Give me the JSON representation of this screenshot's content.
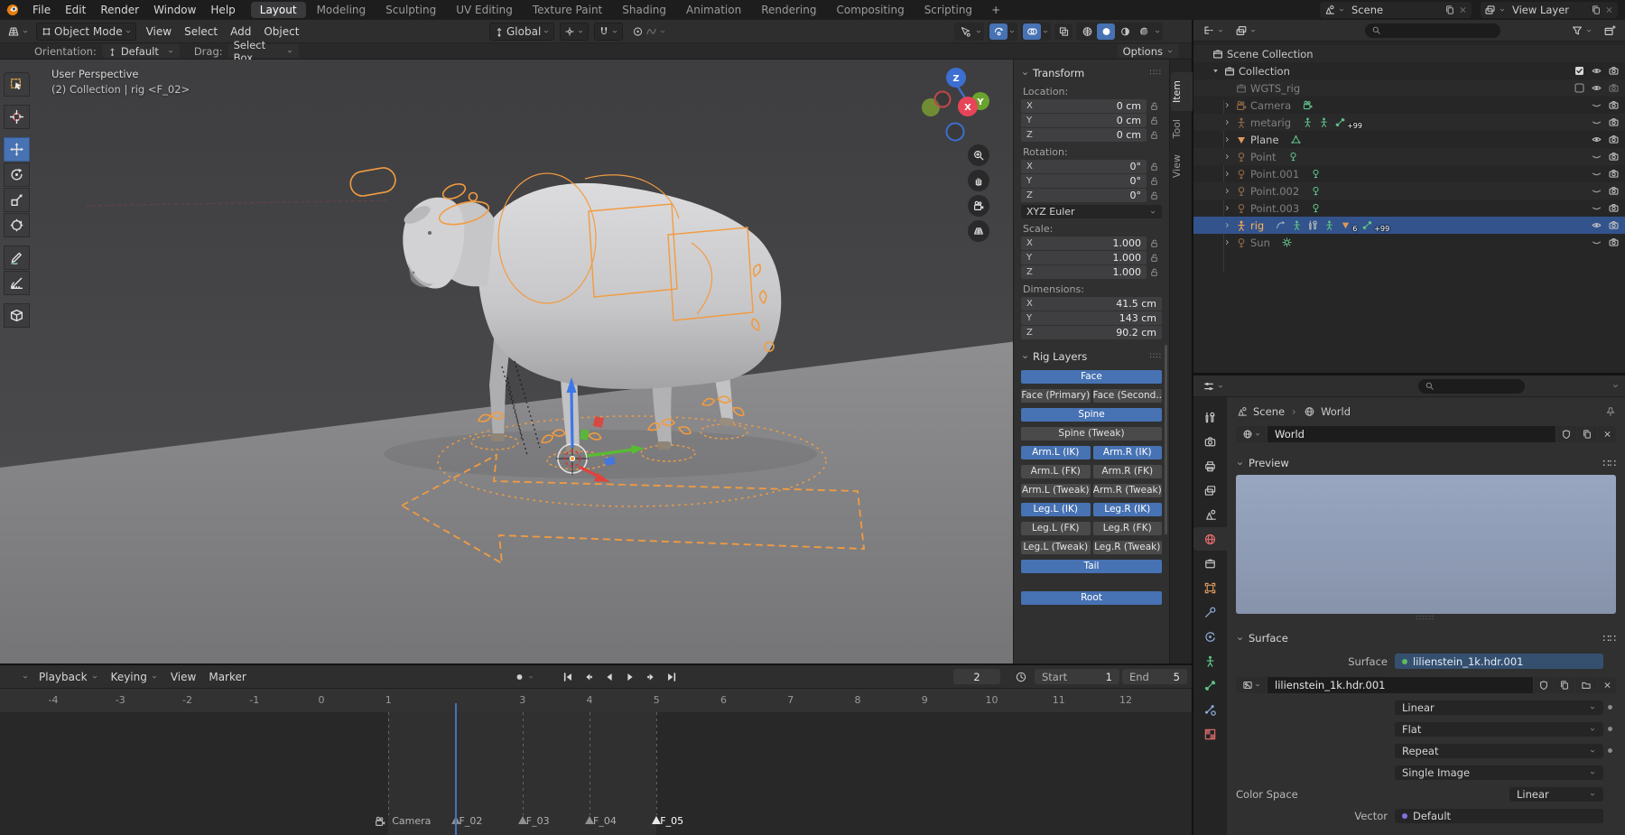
{
  "colors": {
    "accent": "#4772b3",
    "sel-row": "#33538c",
    "rig-orange": "#f29b40",
    "obj-orange": "#de9a5a",
    "data-green": "#5fc186",
    "world-red": "#e06a6a",
    "axis-blue": "#3d77e8",
    "axis-green": "#58bb33",
    "axis-red": "#e0433b",
    "preview-top": "#98a6c0",
    "preview-bottom": "#8793ab",
    "link-field": "#35506e",
    "node-green": "#5fb85f",
    "vector-purple": "#7d74e0"
  },
  "topbar": {
    "menus": [
      "File",
      "Edit",
      "Render",
      "Window",
      "Help"
    ],
    "workspaces": [
      "Layout",
      "Modeling",
      "Sculpting",
      "UV Editing",
      "Texture Paint",
      "Shading",
      "Animation",
      "Rendering",
      "Compositing",
      "Scripting"
    ],
    "active_workspace": "Layout",
    "add_workspace": "+",
    "scene_label": "Scene",
    "view_layer_label": "View Layer"
  },
  "viewport": {
    "header": {
      "mode": "Object Mode",
      "menus": [
        "View",
        "Select",
        "Add",
        "Object"
      ],
      "orientation": "Global",
      "options": "Options"
    },
    "tool_settings": {
      "orientation_label": "Orientation:",
      "orientation_value": "Default",
      "drag_label": "Drag:",
      "drag_value": "Select Box"
    },
    "overlay": {
      "line1": "User Perspective",
      "line2": "(2) Collection | rig <F_02>"
    },
    "gizmo_axes": {
      "x": "X",
      "y": "Y",
      "z": "Z"
    },
    "tools": [
      {
        "name": "tweak-select",
        "icon": "s-t-select",
        "gap_after": true
      },
      {
        "name": "cursor",
        "icon": "s-t-cursor",
        "gap_after": true
      },
      {
        "name": "move",
        "icon": "s-t-move",
        "active": true
      },
      {
        "name": "rotate",
        "icon": "s-t-rotate"
      },
      {
        "name": "scale",
        "icon": "s-t-scale"
      },
      {
        "name": "transform",
        "icon": "s-t-transform",
        "gap_after": true
      },
      {
        "name": "annotate",
        "icon": "s-t-annotate"
      },
      {
        "name": "measure",
        "icon": "s-t-measure",
        "gap_after": true
      },
      {
        "name": "add-cube",
        "icon": "s-t-addcube"
      }
    ]
  },
  "n_panel": {
    "tabs": [
      "Item",
      "Tool",
      "View"
    ],
    "active_tab": "Item",
    "transform": {
      "title": "Transform",
      "rotation_mode": "XYZ Euler",
      "groups": [
        {
          "label": "Location:",
          "locks": true,
          "rows": [
            [
              "X",
              "0 cm"
            ],
            [
              "Y",
              "0 cm"
            ],
            [
              "Z",
              "0 cm"
            ]
          ]
        },
        {
          "label": "Rotation:",
          "locks": true,
          "dropdown": "XYZ Euler",
          "rows": [
            [
              "X",
              "0°"
            ],
            [
              "Y",
              "0°"
            ],
            [
              "Z",
              "0°"
            ]
          ]
        },
        {
          "label": "Scale:",
          "locks": true,
          "rows": [
            [
              "X",
              "1.000"
            ],
            [
              "Y",
              "1.000"
            ],
            [
              "Z",
              "1.000"
            ]
          ]
        },
        {
          "label": "Dimensions:",
          "locks": false,
          "rows": [
            [
              "X",
              "41.5 cm"
            ],
            [
              "Y",
              "143 cm"
            ],
            [
              "Z",
              "90.2 cm"
            ]
          ]
        }
      ]
    },
    "rig_layers": {
      "title": "Rig Layers",
      "rows": [
        [
          {
            "l": "Face",
            "a": 1
          }
        ],
        [
          {
            "l": "Face (Primary)"
          },
          {
            "l": "Face (Second..."
          }
        ],
        [
          {
            "l": "Spine",
            "a": 1
          }
        ],
        [
          {
            "l": "Spine (Tweak)"
          }
        ],
        [
          {
            "l": "Arm.L (IK)",
            "a": 1
          },
          {
            "l": "Arm.R (IK)",
            "a": 1
          }
        ],
        [
          {
            "l": "Arm.L (FK)"
          },
          {
            "l": "Arm.R (FK)"
          }
        ],
        [
          {
            "l": "Arm.L (Tweak)"
          },
          {
            "l": "Arm.R (Tweak)"
          }
        ],
        [
          {
            "l": "Leg.L (IK)",
            "a": 1
          },
          {
            "l": "Leg.R (IK)",
            "a": 1
          }
        ],
        [
          {
            "l": "Leg.L (FK)"
          },
          {
            "l": "Leg.R (FK)"
          }
        ],
        [
          {
            "l": "Leg.L (Tweak)"
          },
          {
            "l": "Leg.R (Tweak)"
          }
        ],
        [
          {
            "l": "Tail",
            "a": 1
          }
        ],
        [
          {
            "l": "Root",
            "a": 1,
            "gap": 1
          }
        ]
      ]
    }
  },
  "outliner": {
    "items": [
      {
        "label": "Scene Collection",
        "level": 0,
        "icon": "s-box",
        "iconc": "#c8c8c8",
        "right": []
      },
      {
        "label": "Collection",
        "level": 1,
        "arrow": "down",
        "icon": "s-box",
        "iconc": "#c8c8c8",
        "right": [
          "check",
          "eye",
          "cam"
        ]
      },
      {
        "label": "WGTS_rig",
        "level": 2,
        "icon": "s-box",
        "iconc": "#9a9a9a",
        "dim": 1,
        "right": [
          "checkoff",
          "eye",
          "camoff"
        ]
      },
      {
        "label": "Camera",
        "level": 2,
        "arrow": "right",
        "icon": "s-camera-obj",
        "iconc": "#de9a5a",
        "dim": 1,
        "data": [
          {
            "i": "s-camera-obj",
            "c": "#5fc186"
          }
        ],
        "right": [
          "eyec",
          "cam"
        ]
      },
      {
        "label": "metarig",
        "level": 2,
        "arrow": "right",
        "icon": "s-person",
        "iconc": "#de9a5a",
        "dim": 1,
        "data": [
          {
            "i": "s-person",
            "c": "#5fc186"
          },
          {
            "i": "s-person",
            "c": "#5fc186"
          },
          {
            "i": "s-bone",
            "c": "#5fc186",
            "badge": "+99"
          }
        ],
        "right": [
          "eyec",
          "cam"
        ]
      },
      {
        "label": "Plane",
        "level": 2,
        "arrow": "right",
        "icon": "s-tridown",
        "iconc": "#de9a5a",
        "data": [
          {
            "i": "s-mesh",
            "c": "#5fc186"
          }
        ],
        "right": [
          "eye",
          "cam"
        ]
      },
      {
        "label": "Point",
        "level": 2,
        "arrow": "right",
        "icon": "s-light",
        "iconc": "#de9a5a",
        "dim": 1,
        "data": [
          {
            "i": "s-light",
            "c": "#5fc186"
          }
        ],
        "right": [
          "eyec",
          "cam"
        ]
      },
      {
        "label": "Point.001",
        "level": 2,
        "arrow": "right",
        "icon": "s-light",
        "iconc": "#de9a5a",
        "dim": 1,
        "data": [
          {
            "i": "s-light",
            "c": "#5fc186"
          }
        ],
        "right": [
          "eyec",
          "cam"
        ]
      },
      {
        "label": "Point.002",
        "level": 2,
        "arrow": "right",
        "icon": "s-light",
        "iconc": "#de9a5a",
        "dim": 1,
        "data": [
          {
            "i": "s-light",
            "c": "#5fc186"
          }
        ],
        "right": [
          "eyec",
          "cam"
        ]
      },
      {
        "label": "Point.003",
        "level": 2,
        "arrow": "right",
        "icon": "s-light",
        "iconc": "#de9a5a",
        "dim": 1,
        "data": [
          {
            "i": "s-light",
            "c": "#5fc186"
          }
        ],
        "right": [
          "eyec",
          "cam"
        ]
      },
      {
        "label": "rig",
        "level": 2,
        "arrow": "right",
        "icon": "s-person",
        "iconc": "#f0a552",
        "selected": 1,
        "data": [
          {
            "i": "s-pose",
            "c": "#9ab0cc"
          },
          {
            "i": "s-person",
            "c": "#5fc186"
          },
          {
            "i": "s-tool",
            "c": "#b8b8b8"
          },
          {
            "i": "s-person",
            "c": "#5fc186"
          },
          {
            "i": "s-tridown",
            "c": "#de9a5a",
            "badge": "6"
          },
          {
            "i": "s-bone",
            "c": "#5fc186",
            "badge": "+99"
          }
        ],
        "right": [
          "eye",
          "cam"
        ]
      },
      {
        "label": "Sun",
        "level": 2,
        "arrow": "right",
        "icon": "s-light",
        "iconc": "#de9a5a",
        "dim": 1,
        "data": [
          {
            "i": "s-sun",
            "c": "#5fc186"
          }
        ],
        "right": [
          "eyec",
          "cam"
        ]
      }
    ]
  },
  "properties": {
    "breadcrumb": {
      "scene": "Scene",
      "world": "World"
    },
    "datablock_name": "World",
    "preview_title": "Preview",
    "surface_title": "Surface",
    "surface_label": "Surface",
    "surface_value": "lilienstein_1k.hdr.001",
    "image_name": "lilienstein_1k.hdr.001",
    "interpolation": "Linear",
    "projection": "Flat",
    "extension": "Repeat",
    "source": "Single Image",
    "color_space_label": "Color Space",
    "color_space": "Linear",
    "vector_label": "Vector",
    "vector_value": "Default",
    "tabs": [
      {
        "n": "tool",
        "i": "s-tool",
        "c": "#c2c2c2"
      },
      {
        "n": "render",
        "i": "s-cam",
        "c": "#c2c2c2"
      },
      {
        "n": "output",
        "i": "s-printer",
        "c": "#c2c2c2"
      },
      {
        "n": "view-layer",
        "i": "s-images",
        "c": "#c2c2c2"
      },
      {
        "n": "scene",
        "i": "s-scene",
        "c": "#c2c2c2"
      },
      {
        "n": "world",
        "i": "s-world",
        "c": "#e06a6a",
        "active": 1
      },
      {
        "n": "collection",
        "i": "s-box",
        "c": "#c2c2c2"
      },
      {
        "n": "object",
        "i": "s-objsq",
        "c": "#de9a5a"
      },
      {
        "n": "modifiers",
        "i": "s-wrench",
        "c": "#8fb0dd"
      },
      {
        "n": "physics",
        "i": "s-physics",
        "c": "#8fb0dd"
      },
      {
        "n": "object-data",
        "i": "s-person",
        "c": "#5fc186"
      },
      {
        "n": "bone",
        "i": "s-bone",
        "c": "#5fc186"
      },
      {
        "n": "bone-constraints",
        "i": "s-bonec",
        "c": "#8fb0dd"
      },
      {
        "n": "texture",
        "i": "s-checker",
        "c": "#d66a6a"
      }
    ]
  },
  "timeline": {
    "menus": [
      {
        "l": "Playback",
        "chev": 1
      },
      {
        "l": "Keying",
        "chev": 1
      },
      {
        "l": "View"
      },
      {
        "l": "Marker"
      }
    ],
    "current_frame": 2,
    "start_label": "Start",
    "start_value": "1",
    "end_label": "End",
    "end_value": "5",
    "ruler_frames": [
      -4,
      -3,
      -2,
      -1,
      0,
      1,
      2,
      3,
      4,
      5,
      6,
      7,
      8,
      9,
      10,
      11,
      12
    ],
    "markers": [
      {
        "frame": 1,
        "label": "Camera",
        "camera": true
      },
      {
        "frame": 2,
        "label": "F_02"
      },
      {
        "frame": 3,
        "label": "F_03"
      },
      {
        "frame": 4,
        "label": "F_04"
      },
      {
        "frame": 5,
        "label": "F_05",
        "selected": true
      }
    ]
  }
}
